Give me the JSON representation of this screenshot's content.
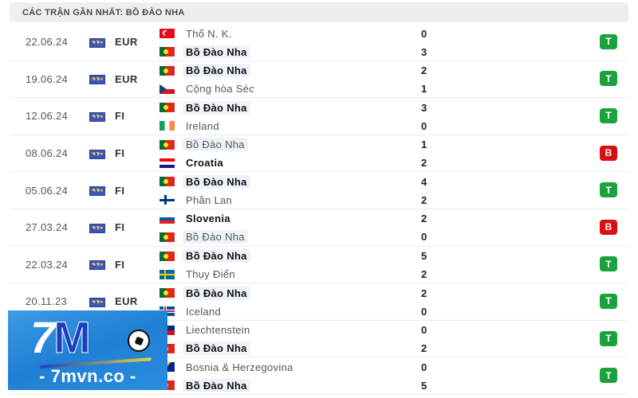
{
  "header": {
    "title": "CÁC TRẬN GẦN NHẤT: BỒ ĐÀO NHA"
  },
  "colors": {
    "win": "#1aa33c",
    "loss": "#d90f0f",
    "header_bg": "#eeeeee",
    "highlight": "#eef3f9"
  },
  "matches": [
    {
      "date": "22.06.24",
      "competition": "EUR",
      "competition_icon": "world-map-icon",
      "home": {
        "name": "Thổ N. K.",
        "flag": "turkey",
        "bold": false,
        "highlight": false
      },
      "home_score": "0",
      "away": {
        "name": "Bồ Đào Nha",
        "flag": "portugal",
        "bold": true,
        "highlight": true
      },
      "away_score": "3",
      "result": "T",
      "result_type": "win"
    },
    {
      "date": "19.06.24",
      "competition": "EUR",
      "competition_icon": "world-map-icon",
      "home": {
        "name": "Bồ Đào Nha",
        "flag": "portugal",
        "bold": true,
        "highlight": true
      },
      "home_score": "2",
      "away": {
        "name": "Cộng hòa Séc",
        "flag": "czech",
        "bold": false,
        "highlight": false
      },
      "away_score": "1",
      "result": "T",
      "result_type": "win"
    },
    {
      "date": "12.06.24",
      "competition": "FI",
      "competition_icon": "world-map-icon",
      "home": {
        "name": "Bồ Đào Nha",
        "flag": "portugal",
        "bold": true,
        "highlight": true
      },
      "home_score": "3",
      "away": {
        "name": "Ireland",
        "flag": "ireland",
        "bold": false,
        "highlight": false
      },
      "away_score": "0",
      "result": "T",
      "result_type": "win"
    },
    {
      "date": "08.06.24",
      "competition": "FI",
      "competition_icon": "world-map-icon",
      "home": {
        "name": "Bồ Đào Nha",
        "flag": "portugal",
        "bold": false,
        "highlight": true
      },
      "home_score": "1",
      "away": {
        "name": "Croatia",
        "flag": "croatia",
        "bold": true,
        "highlight": false
      },
      "away_score": "2",
      "result": "B",
      "result_type": "loss"
    },
    {
      "date": "05.06.24",
      "competition": "FI",
      "competition_icon": "world-map-icon",
      "home": {
        "name": "Bồ Đào Nha",
        "flag": "portugal",
        "bold": true,
        "highlight": true
      },
      "home_score": "4",
      "away": {
        "name": "Phần Lan",
        "flag": "finland",
        "bold": false,
        "highlight": false
      },
      "away_score": "2",
      "result": "T",
      "result_type": "win"
    },
    {
      "date": "27.03.24",
      "competition": "FI",
      "competition_icon": "world-map-icon",
      "home": {
        "name": "Slovenia",
        "flag": "slovenia",
        "bold": true,
        "highlight": false
      },
      "home_score": "2",
      "away": {
        "name": "Bồ Đào Nha",
        "flag": "portugal",
        "bold": false,
        "highlight": true
      },
      "away_score": "0",
      "result": "B",
      "result_type": "loss"
    },
    {
      "date": "22.03.24",
      "competition": "FI",
      "competition_icon": "world-map-icon",
      "home": {
        "name": "Bồ Đào Nha",
        "flag": "portugal",
        "bold": true,
        "highlight": true
      },
      "home_score": "5",
      "away": {
        "name": "Thụy Điển",
        "flag": "sweden",
        "bold": false,
        "highlight": false
      },
      "away_score": "2",
      "result": "T",
      "result_type": "win"
    },
    {
      "date": "20.11.23",
      "competition": "EUR",
      "competition_icon": "world-map-icon",
      "home": {
        "name": "Bồ Đào Nha",
        "flag": "portugal",
        "bold": true,
        "highlight": true
      },
      "home_score": "2",
      "away": {
        "name": "Iceland",
        "flag": "iceland",
        "bold": false,
        "highlight": false
      },
      "away_score": "0",
      "result": "T",
      "result_type": "win"
    },
    {
      "date": "",
      "competition": "",
      "competition_icon": "world-map-icon",
      "home": {
        "name": "Liechtenstein",
        "flag": "liechtenstein",
        "bold": false,
        "highlight": false
      },
      "home_score": "0",
      "away": {
        "name": "Bồ Đào Nha",
        "flag": "portugal",
        "bold": true,
        "highlight": true
      },
      "away_score": "2",
      "result": "T",
      "result_type": "win"
    },
    {
      "date": "",
      "competition": "",
      "competition_icon": "world-map-icon",
      "home": {
        "name": "Bosnia & Herzegovina",
        "flag": "bosnia",
        "bold": false,
        "highlight": false
      },
      "home_score": "0",
      "away": {
        "name": "Bồ Đào Nha",
        "flag": "portugal",
        "bold": true,
        "highlight": true
      },
      "away_score": "5",
      "result": "T",
      "result_type": "win"
    }
  ],
  "watermark": {
    "logo_seven": "7",
    "logo_m": "M",
    "site": "- 7mvn.co -"
  }
}
